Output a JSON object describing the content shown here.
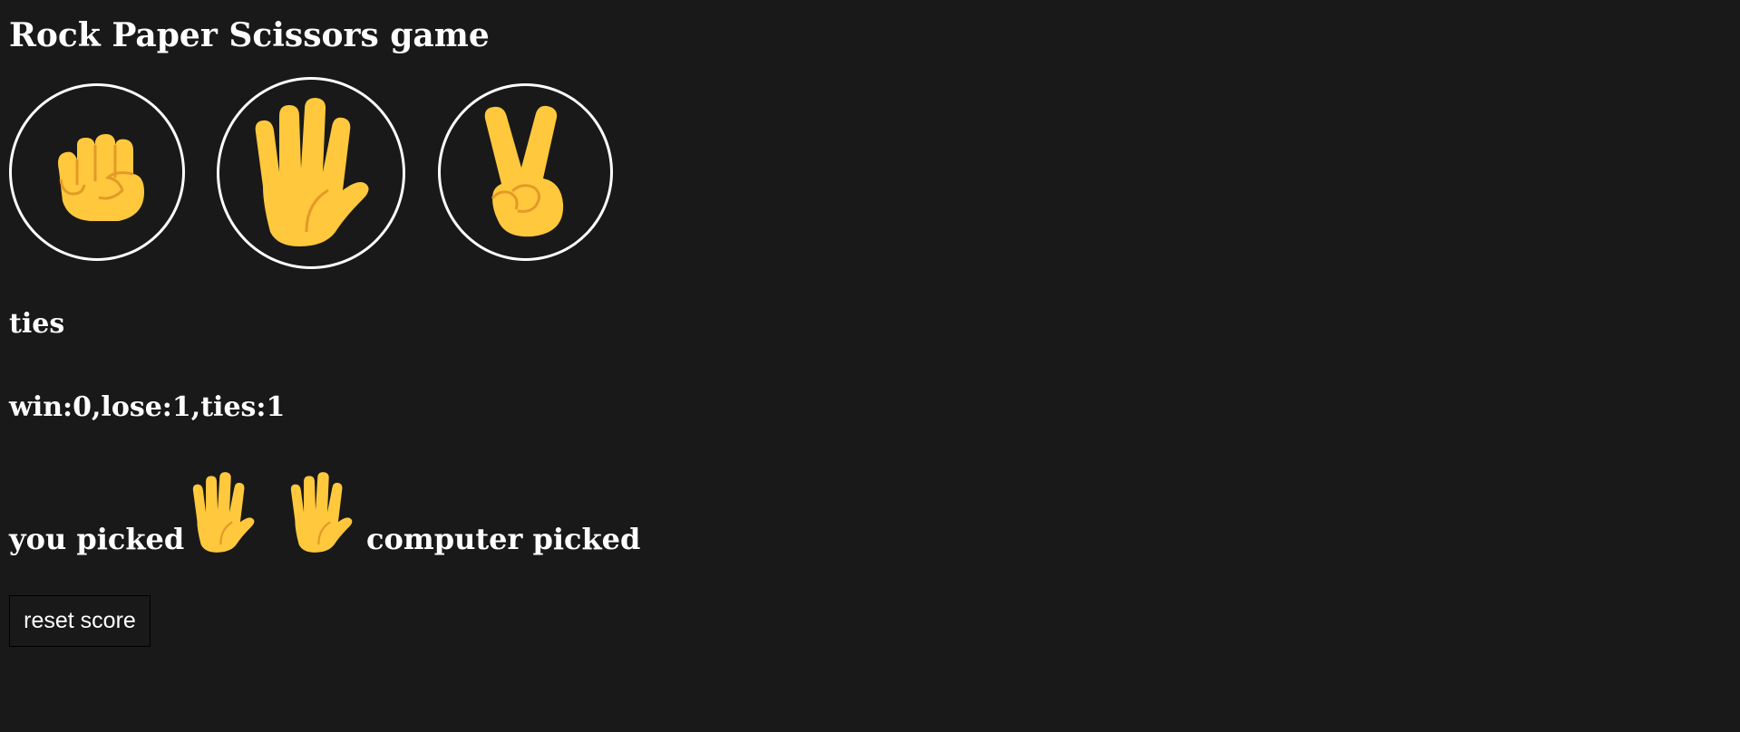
{
  "title": "Rock Paper Scissors game",
  "choices": [
    {
      "name": "rock",
      "icon": "raised-fist-icon"
    },
    {
      "name": "paper",
      "icon": "raised-hand-icon"
    },
    {
      "name": "scissors",
      "icon": "victory-hand-icon"
    }
  ],
  "result": "ties",
  "score_text": "win:0,lose:1,ties:1",
  "picks": {
    "you_label": "you picked",
    "computer_label": "computer picked",
    "you_icon": "raised-hand-icon",
    "computer_icon": "raised-hand-icon"
  },
  "reset_label": "reset score",
  "colors": {
    "background": "#191919",
    "text": "#ffffff",
    "emoji_yellow": "#FFC83D",
    "emoji_shade": "#E39A26"
  }
}
